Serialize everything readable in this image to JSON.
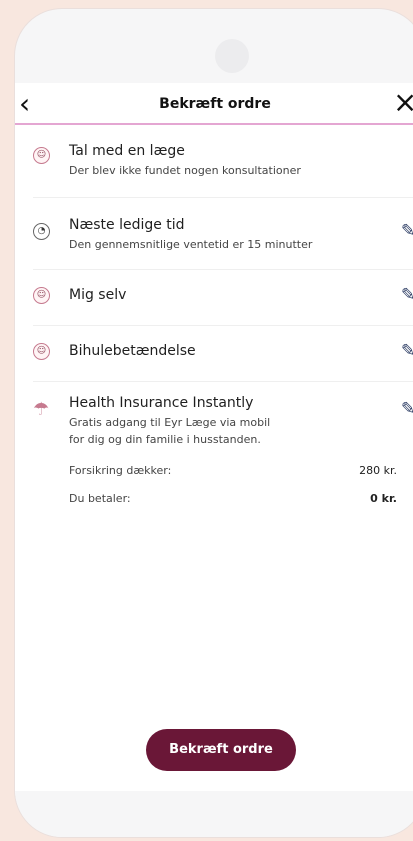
{
  "header": {
    "title": "Bekræft ordre",
    "back_icon": "chevron-left-icon",
    "close_icon": "close-icon"
  },
  "items": [
    {
      "title": "Tal med en læge",
      "subtitle": "Der blev ikke fundet nogen konsultationer",
      "icon": "doctor-icon",
      "editable": false
    },
    {
      "title": "Næste ledige tid",
      "subtitle": "Den gennemsnitlige ventetid er 15 minutter",
      "icon": "clock-icon",
      "editable": true
    },
    {
      "title": "Mig selv",
      "subtitle": "",
      "icon": "person-icon",
      "editable": true
    },
    {
      "title": "Bihulebetændelse",
      "subtitle": "",
      "icon": "sinus-icon",
      "editable": true
    },
    {
      "title": "Health Insurance Instantly",
      "subtitle_line1": "Gratis adgang til Eyr Læge via mobil",
      "subtitle_line2": "for dig og din familie i husstanden.",
      "icon": "umbrella-icon",
      "editable": true,
      "prices": [
        {
          "label": "Forsikring dækker:",
          "value": "280 kr."
        },
        {
          "label": "Du betaler:",
          "value": "0 kr."
        }
      ]
    }
  ],
  "footer": {
    "button_label": "Bekræft ordre"
  },
  "colors": {
    "background": "#f8e7df",
    "accent": "#6a1737",
    "divider_accent": "#e4a6d2"
  }
}
